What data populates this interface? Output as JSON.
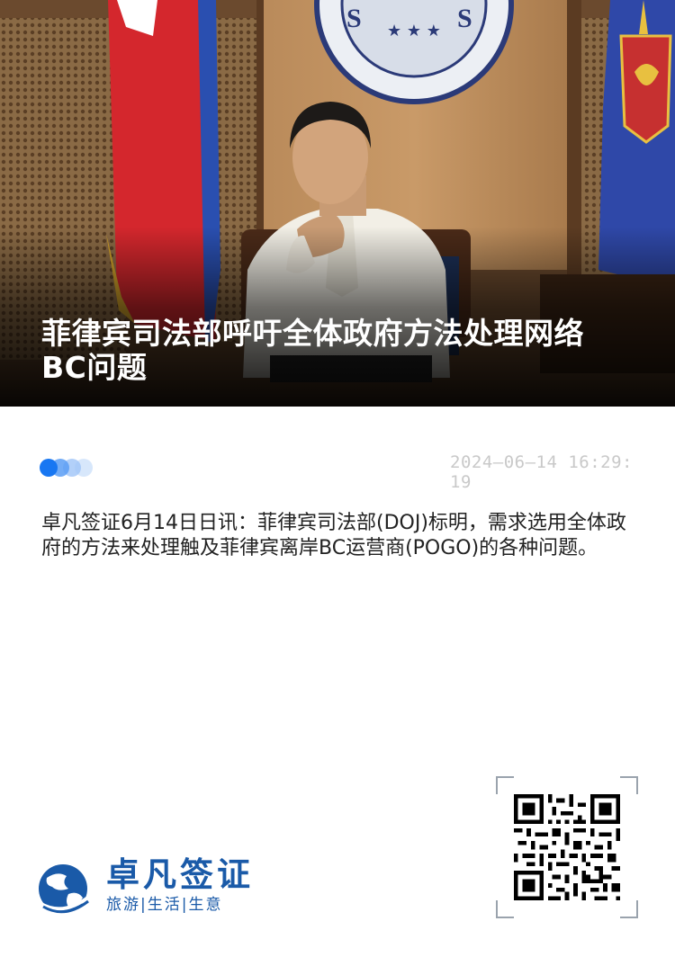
{
  "article": {
    "title": "菲律宾司法部呼吁全体政府方法处理网络BC问题",
    "datetime": "2024–06–14 16:29:19",
    "body": "卓凡签证6月14日日讯：菲律宾司法部(DOJ)标明，需求选用全体政府的方法来处理触及菲律宾离岸BC运营商(POGO)的各种问题。"
  },
  "brand": {
    "name": "卓凡签证",
    "tagline": "旅游|生活|生意"
  },
  "colors": {
    "brand_blue": "#1a5aa8",
    "dot_blue": "#1877f2",
    "timestamp_gray": "#c9c9c9"
  },
  "icons": {
    "logo": "globe-logo-icon",
    "qr": "qr-code-icon"
  }
}
